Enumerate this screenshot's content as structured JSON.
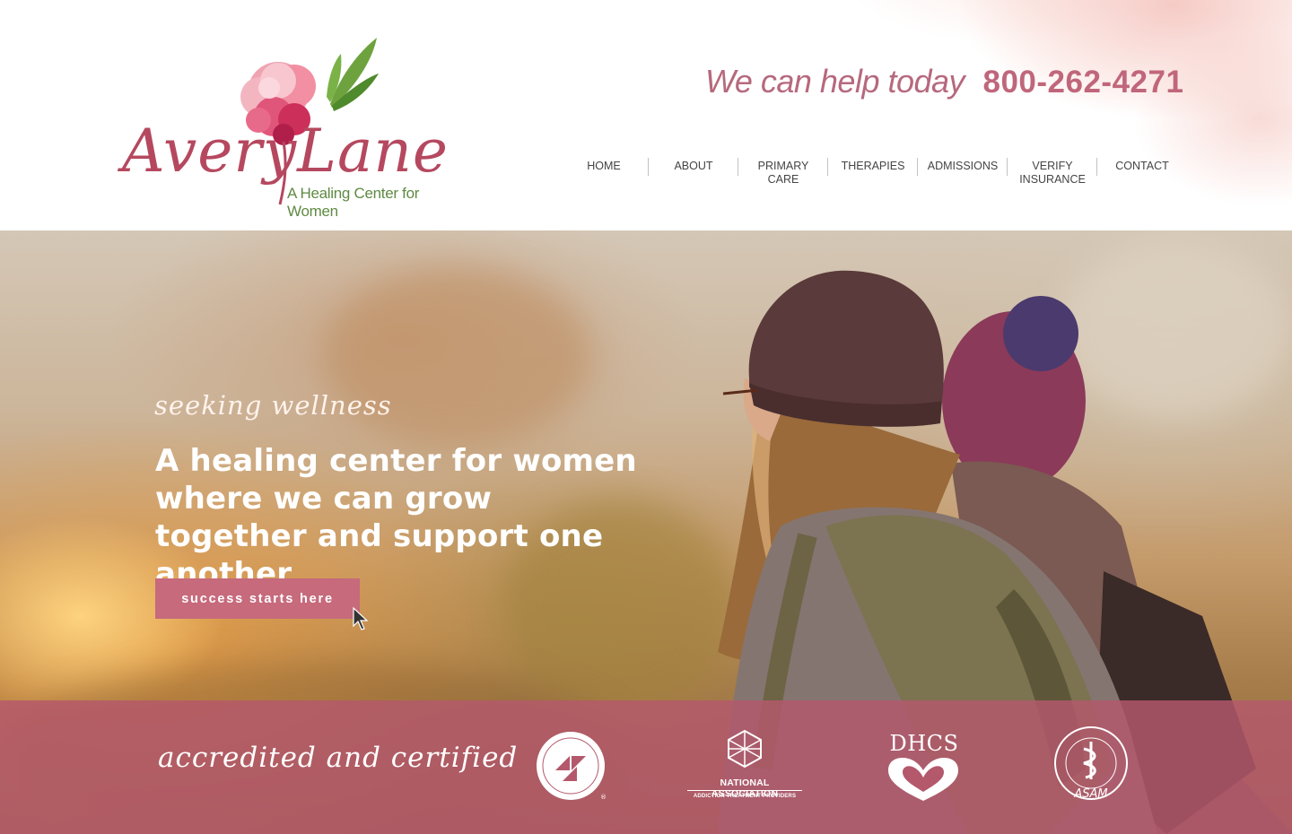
{
  "header": {
    "logo": {
      "name": "AveryLane",
      "tagline": "A Healing Center for Women"
    },
    "help_text": "We can help today",
    "phone": "800-262-4271",
    "nav": [
      {
        "label": "HOME"
      },
      {
        "label": "ABOUT"
      },
      {
        "label": "PRIMARY CARE"
      },
      {
        "label": "THERAPIES"
      },
      {
        "label": "ADMISSIONS"
      },
      {
        "label": "VERIFY INSURANCE"
      },
      {
        "label": "CONTACT"
      }
    ]
  },
  "hero": {
    "kicker": "seeking wellness",
    "title": "A healing center for women where we can grow together and support one another",
    "cta_label": "success starts here"
  },
  "accreditation": {
    "title": "accredited and certified",
    "badges": [
      {
        "name": "The Joint Commission"
      },
      {
        "name": "National Association of Addiction Treatment Providers",
        "text_main": "NATIONAL ASSOCIATION",
        "text_sub": "ADDICTION TREATMENT PROVIDERS"
      },
      {
        "name": "DHCS",
        "text_main": "DHCS"
      },
      {
        "name": "American Society of Addiction Medicine",
        "text_main": "ASAM"
      }
    ]
  },
  "colors": {
    "brand_rose": "#c66a7c",
    "logo_red": "#b5485f",
    "tagline_green": "#5f8a43",
    "band": "#b4586c"
  }
}
